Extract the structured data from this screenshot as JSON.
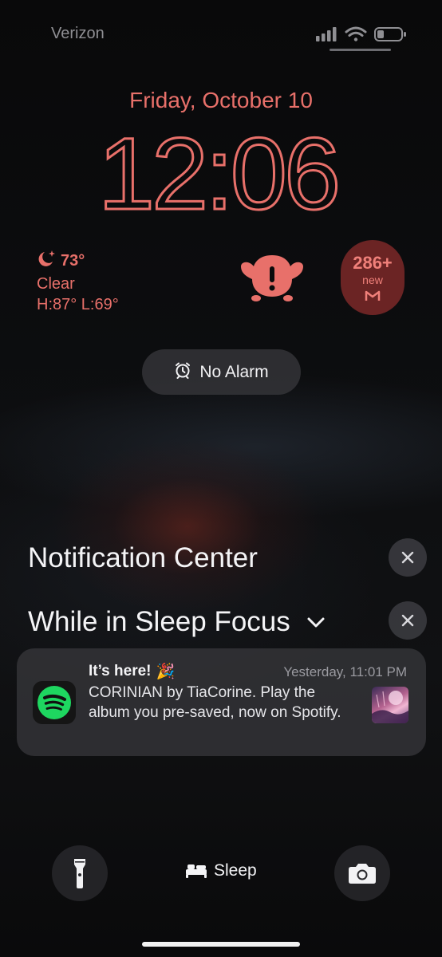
{
  "status_bar": {
    "carrier": "Verizon",
    "icons": [
      "signal-icon",
      "wifi-icon",
      "battery-icon"
    ]
  },
  "lock_screen": {
    "date": "Friday, October 10",
    "time": "12:06",
    "accent_color": "#e8706a"
  },
  "widgets": {
    "weather": {
      "icon": "moon-icon",
      "temperature": "73°",
      "condition": "Clear",
      "high_low": "H:87° L:69°"
    },
    "app_widget": {
      "icon": "alert-creature-icon"
    },
    "mail": {
      "count": "286+",
      "label": "new",
      "icon": "gmail-icon"
    }
  },
  "alarm": {
    "icon": "alarm-clock-icon",
    "label": "No Alarm"
  },
  "notification_center": {
    "title": "Notification Center",
    "focus_group": "While in Sleep Focus",
    "notification": {
      "app": "Spotify",
      "icon": "spotify-icon",
      "title": "It’s here!",
      "emoji": "🎉",
      "time": "Yesterday, 11:01 PM",
      "body": "CORINIAN by TiaCorine. Play the album you pre-saved, now on Spotify."
    }
  },
  "bottom": {
    "flashlight_icon": "flashlight-icon",
    "sleep_icon": "bed-icon",
    "sleep_label": "Sleep",
    "camera_icon": "camera-icon"
  }
}
